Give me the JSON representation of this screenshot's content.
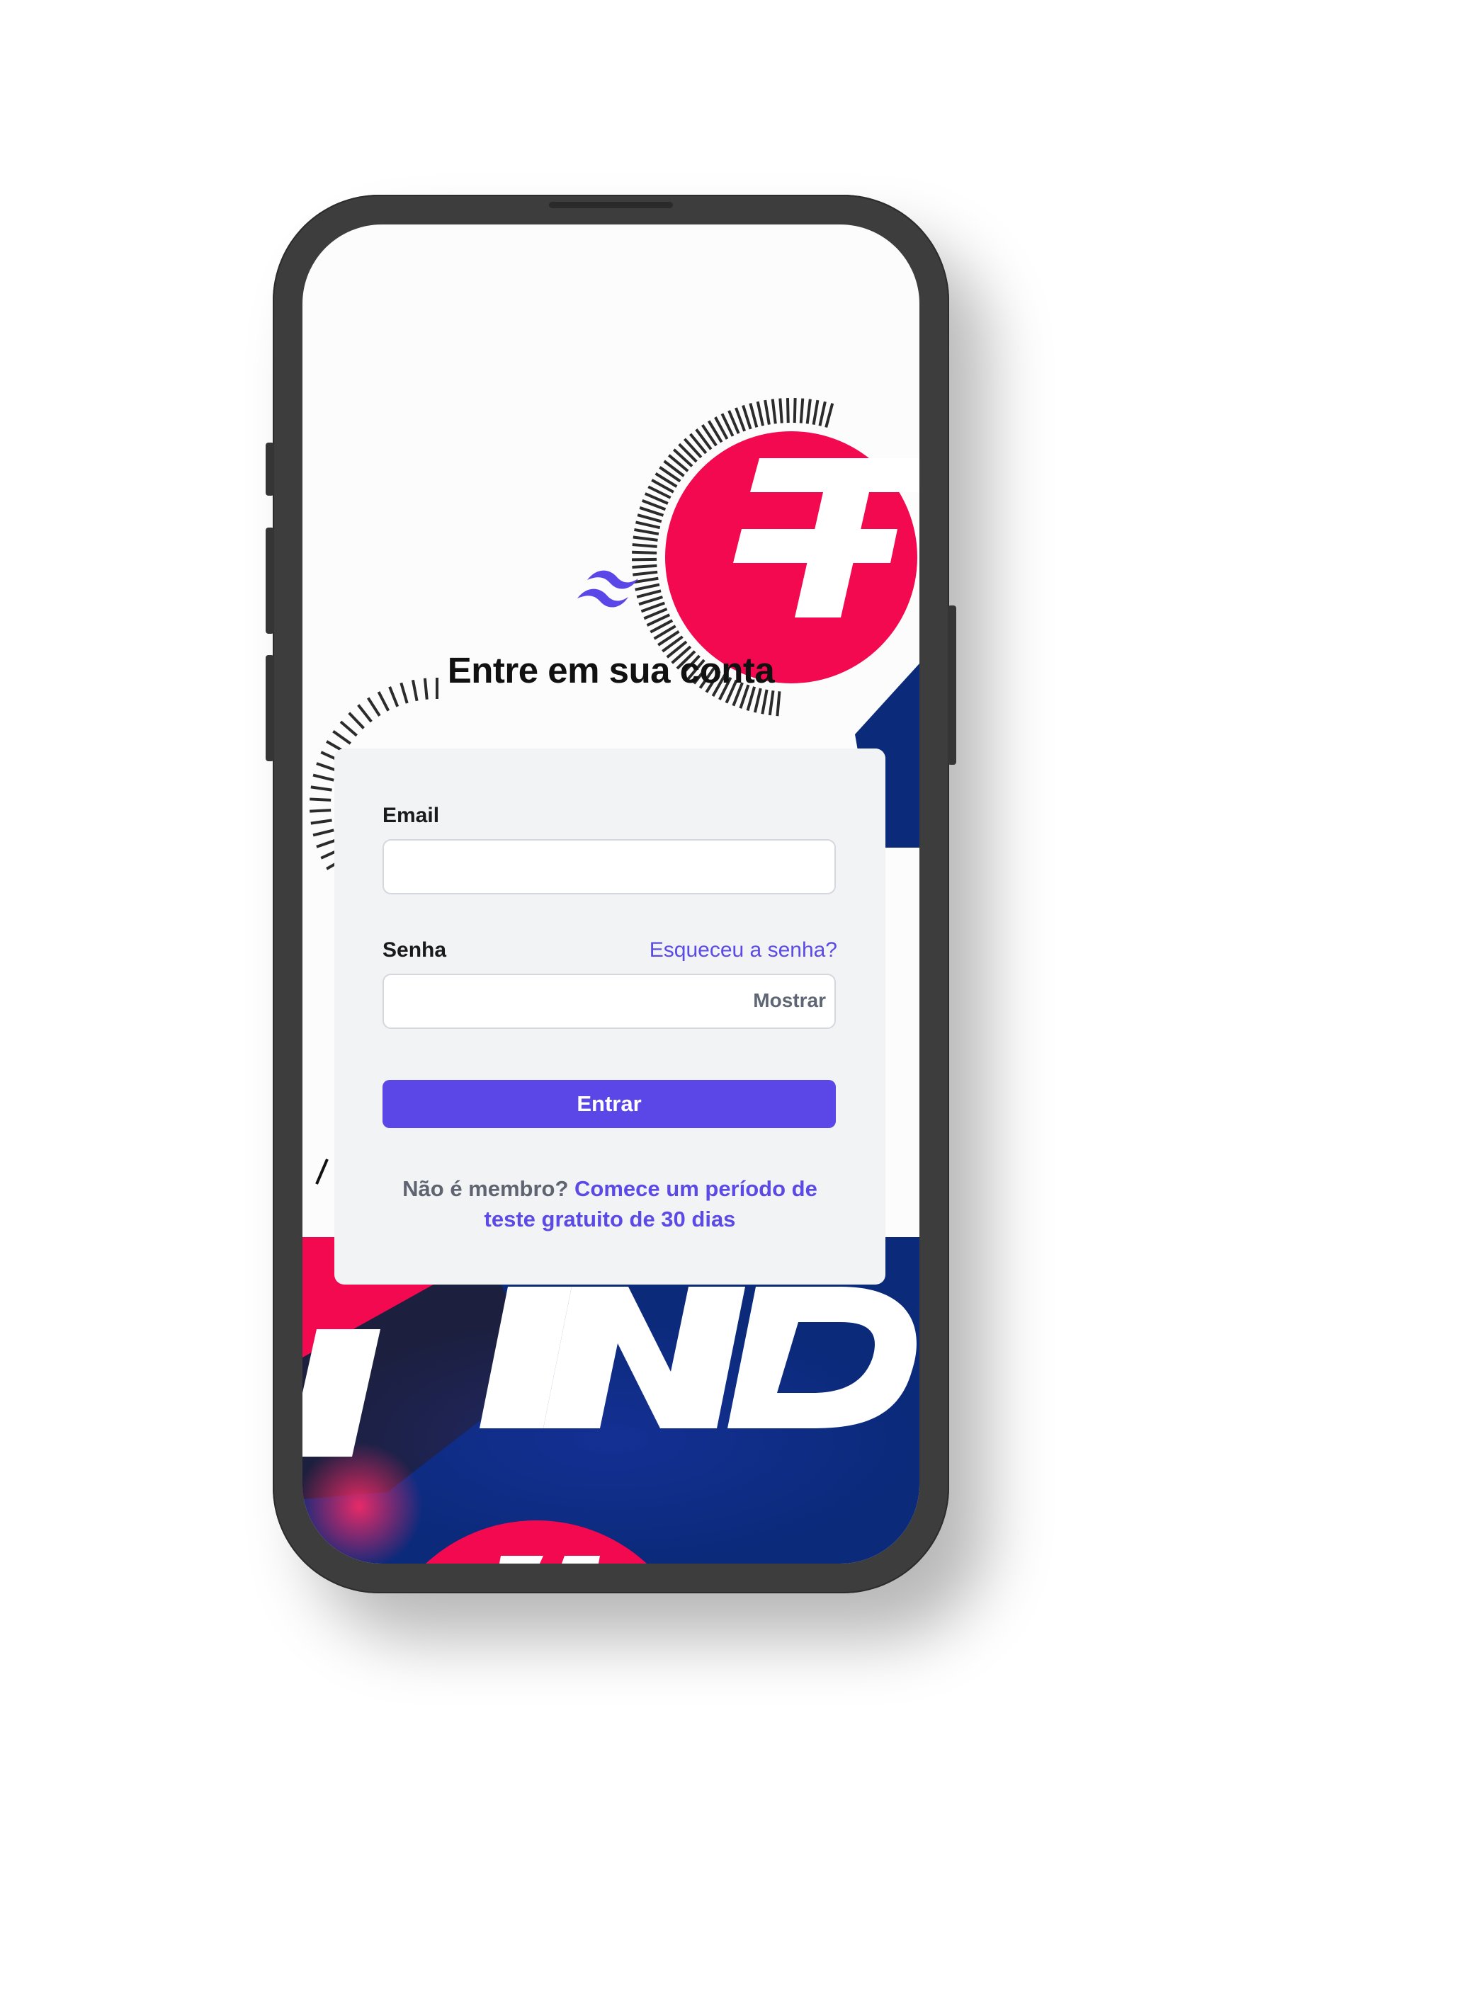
{
  "app": {
    "title": "Entre em sua conta",
    "logo_icon": "tailwind-wave-icon"
  },
  "form": {
    "email_label": "Email",
    "email_value": "",
    "password_label": "Senha",
    "password_value": "",
    "forgot_link": "Esqueceu a senha?",
    "show_toggle": "Mostrar",
    "submit_label": "Entrar"
  },
  "footer": {
    "prompt": "Não é membro?",
    "link": "Comece um período de teste gratuito de 30 dias"
  },
  "colors": {
    "accent": "#5b46e8",
    "link": "#5b4ae6",
    "card_bg": "#f2f3f5",
    "art_red": "#f2094f",
    "art_navy": "#0b2a7a"
  }
}
